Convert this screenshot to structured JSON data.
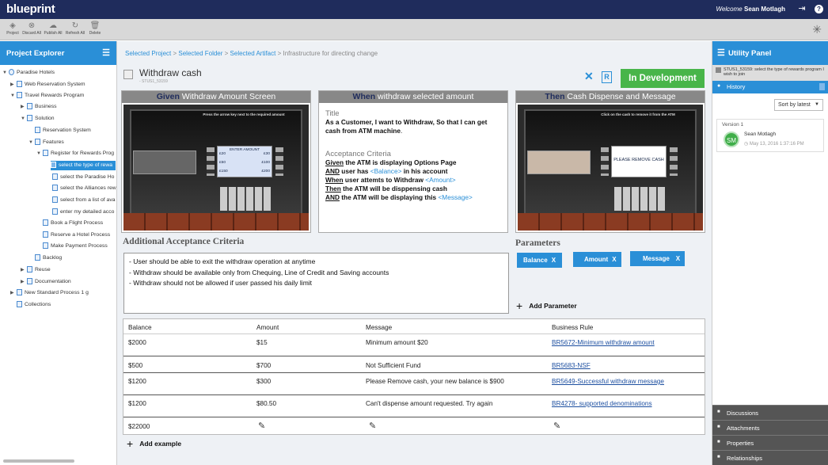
{
  "topbar": {
    "logo": "blueprint",
    "welcome_prefix": "Welcome",
    "user_name": "Sean Motlagh"
  },
  "toolbar": {
    "items": [
      {
        "label": "Project",
        "icon": "project-icon"
      },
      {
        "label": "Discard All",
        "icon": "discard-icon"
      },
      {
        "label": "Publish All",
        "icon": "publish-icon"
      },
      {
        "label": "Refresh All",
        "icon": "refresh-icon"
      },
      {
        "label": "Delete",
        "icon": "trash-icon"
      }
    ]
  },
  "explorer": {
    "title": "Project Explorer",
    "tree": [
      {
        "label": "Paradise Hotels"
      },
      {
        "label": "Web Reservation System"
      },
      {
        "label": "Travel Rewards Program"
      },
      {
        "label": "Business"
      },
      {
        "label": "Solution"
      },
      {
        "label": "Reservation System"
      },
      {
        "label": "Features"
      },
      {
        "label": "Register for Rewards Prog"
      },
      {
        "label": "select the type of rewa"
      },
      {
        "label": "select the Paradise Ho"
      },
      {
        "label": "select the Alliances rew"
      },
      {
        "label": "select from a list of ava"
      },
      {
        "label": "enter my detailed acco"
      },
      {
        "label": "Book a Flight Process"
      },
      {
        "label": "Reserve a Hotel Process"
      },
      {
        "label": "Make Payment Process"
      },
      {
        "label": "Backlog"
      },
      {
        "label": "Reuse"
      },
      {
        "label": "Documentation"
      },
      {
        "label": "New Standard Process 1 g"
      },
      {
        "label": "Collections"
      }
    ]
  },
  "breadcrumb": {
    "items": [
      "Selected Project",
      "Selected Folder",
      "Selected Artifact"
    ],
    "current": "Infrastructure for directing change",
    "sep": " > "
  },
  "artifact": {
    "title": "Withdraw cash",
    "id": "- STUS1_53159",
    "status": "In Development"
  },
  "given": {
    "keyword": "Given",
    "text": " Withdraw Amount Screen",
    "atm_prompt": "Press the arrow key next to the required amount",
    "screen_header": "ENTER  AMOUNT",
    "amounts_left": [
      "£20",
      "£50",
      "£150"
    ],
    "amounts_right": [
      "£30",
      "£100",
      "£200"
    ]
  },
  "when": {
    "keyword": "When",
    "text": " withdraw selected amount",
    "title_label": "Title",
    "title_line": {
      "as_a": "As a ",
      "role": "Customer",
      "i_want": ", I want to ",
      "action": "Withdraw",
      "so_that": ", So that I can get cash from ATM machine",
      "period": "."
    },
    "ac_label": "Acceptance Criteria",
    "criteria": [
      {
        "kw": "Given",
        "text": " the ATM is displaying Options Page",
        "ph": ""
      },
      {
        "kw": "AND",
        "text": " user has ",
        "ph": "<Balance>",
        "after": " in his account"
      },
      {
        "kw": "When",
        "text": "  user attemts to Withdraw ",
        "ph": "<Amount>",
        "after": ""
      },
      {
        "kw": "Then",
        "text": " the ATM will be disppensing cash",
        "ph": "",
        "after": ""
      },
      {
        "kw": "AND",
        "text": " the ATM will be displaying this ",
        "ph": "<Message>",
        "after": ""
      }
    ]
  },
  "then": {
    "keyword": "Then",
    "text": " Cash Dispense and Message",
    "atm_prompt": "Click on the cash to remove it from the ATM",
    "screen_msg": "PLEASE  REMOVE CASH"
  },
  "additional": {
    "title": "Additional Acceptance Criteria",
    "items": [
      "-   User should  be able to exit the withdraw operation  at anytime",
      "-   Withdraw  should  be available only from Chequing,  Line of Credit  and Saving accounts",
      "-   Withdraw  should  not be allowed  if user passed  his daily limit"
    ]
  },
  "parameters": {
    "title": "Parameters",
    "chips": [
      "Balance",
      "Amount",
      "Message"
    ],
    "remove_glyph": "X",
    "add_label": "Add Parameter"
  },
  "examples": {
    "headers": [
      "Balance",
      "Amount",
      "Message",
      "Business Rule"
    ],
    "rows": [
      {
        "balance": "$2000",
        "amount": "$15",
        "message": "Minimum amount $20",
        "rule": "BR5672-Minimum withdraw amount"
      },
      {
        "balance": "$500",
        "amount": "$700",
        "message": "Not Sufficient Fund",
        "rule": "BR5683-NSF"
      },
      {
        "balance": "$1200",
        "amount": "$300",
        "message": "Please Remove cash, your new balance is $900",
        "rule": "BR5649-Successful withdraw message"
      },
      {
        "balance": "$1200",
        "amount": "$80.50",
        "message": "Can't dispense amount requested.  Try again",
        "rule": "BR4278- supported denominations"
      }
    ],
    "new_row_balance": "$22000",
    "add_label": "Add example"
  },
  "utility": {
    "title": "Utility Panel",
    "artifact_line": "STUS1_53159: select the type of rewards program I wish to join",
    "history_label": "History",
    "sort_label": "Sort by latest",
    "version": {
      "label": "Version 1",
      "initials": "SM",
      "user": "Sean Motlagh",
      "date": "May 13, 2016 1:37:16 PM"
    },
    "footer": [
      "Discussions",
      "Attachments",
      "Properties",
      "Relationships"
    ]
  },
  "colors": {
    "topbar": "#1f2c5c",
    "accent": "#2a8fd7",
    "status_green": "#48b54a"
  }
}
